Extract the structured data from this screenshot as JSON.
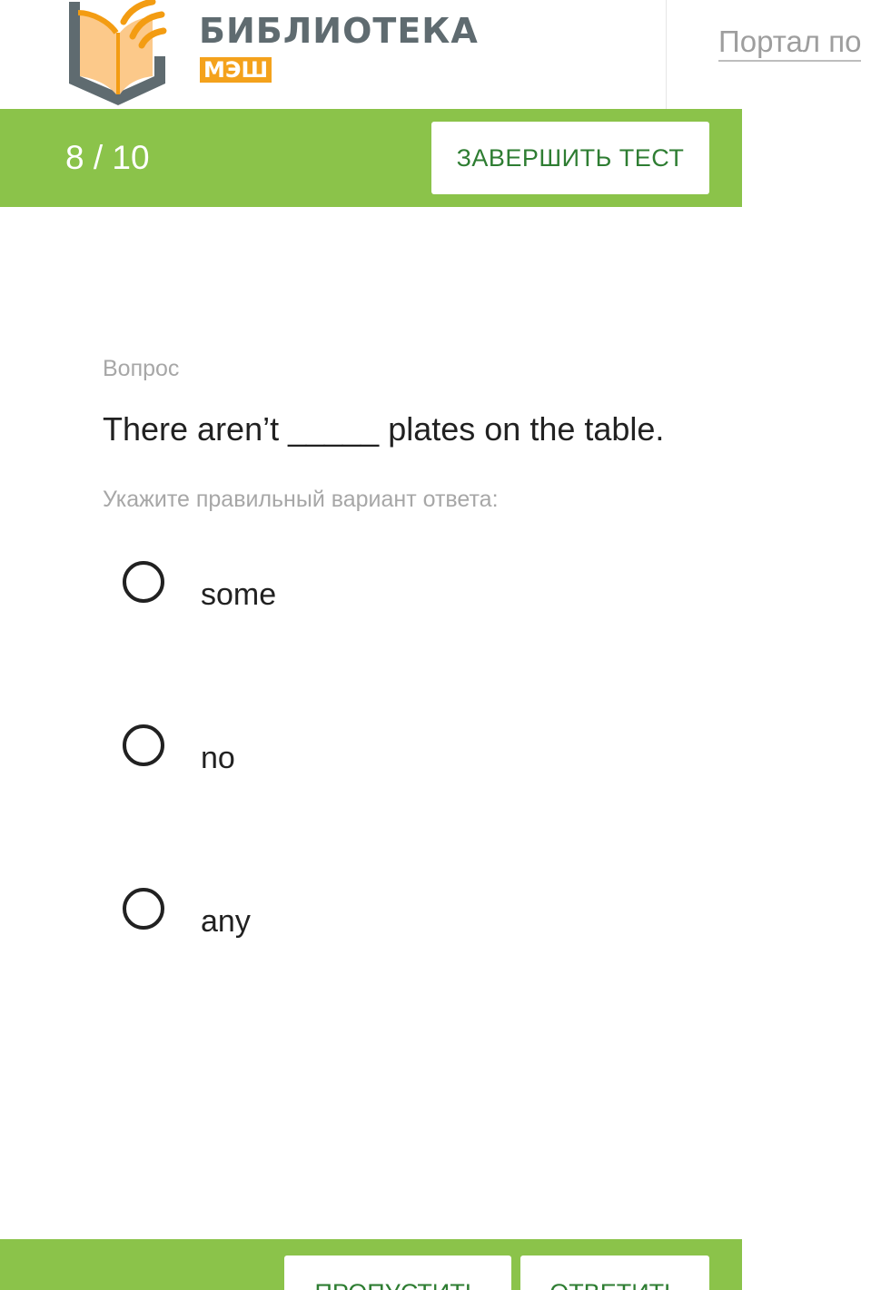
{
  "header": {
    "logo_title": "БИБЛИОТЕКА",
    "logo_sub": "МЭШ",
    "portal_link": "Портал по"
  },
  "progress": {
    "text": "8 / 10",
    "current": 8,
    "total": 10
  },
  "toolbar": {
    "finish_label": "ЗАВЕРШИТЬ ТЕСТ"
  },
  "question": {
    "label": "Вопрос",
    "text": "There aren’t _____ plates on the table.",
    "hint": "Укажите правильный вариант ответа:",
    "options": [
      {
        "label": "some",
        "selected": false
      },
      {
        "label": "no",
        "selected": false
      },
      {
        "label": "any",
        "selected": false
      }
    ]
  },
  "footer": {
    "skip_label": "ПРОПУСТИТЬ",
    "answer_label": "ОТВЕТИТЬ"
  },
  "colors": {
    "accent_green": "#8bc34a",
    "button_text_green": "#2e7d32",
    "logo_orange": "#f4a21c",
    "logo_gray": "#5f6b70"
  },
  "icons": {
    "logo": "book-with-signal-waves-icon",
    "radio": "radio-unchecked-icon"
  }
}
